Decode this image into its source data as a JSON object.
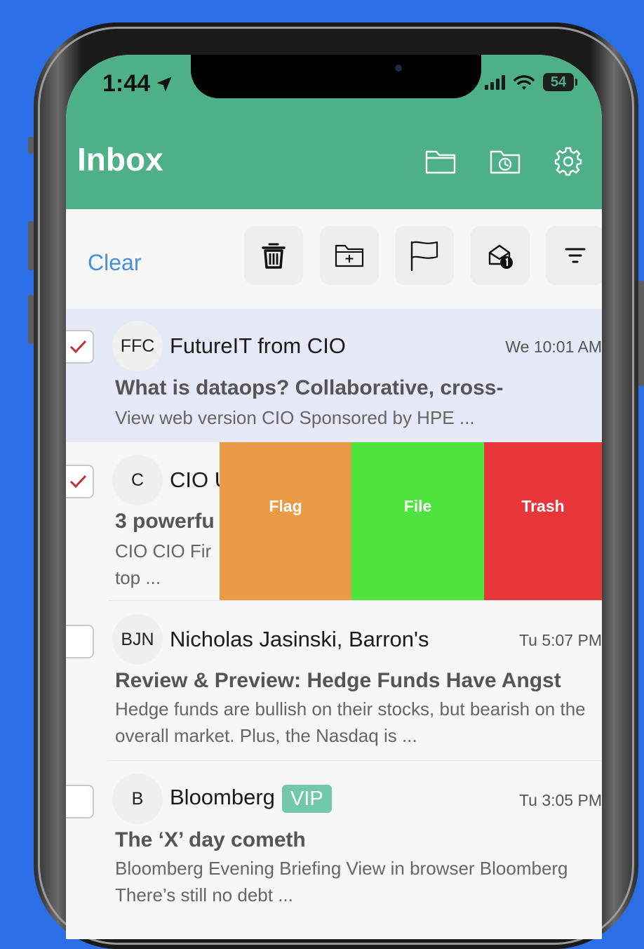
{
  "status_bar": {
    "time": "1:44",
    "battery": "54"
  },
  "header": {
    "title": "Inbox"
  },
  "toolbar": {
    "clear_label": "Clear"
  },
  "swipe_actions": {
    "flag": "Flag",
    "file": "File",
    "trash": "Trash"
  },
  "colors": {
    "header": "#4db088",
    "accent_link": "#4a8fd9",
    "flag": "#eb9b45",
    "file": "#4de43d",
    "trash": "#e7373b",
    "vip": "#73c7ab",
    "selected_row": "#e6eaf8"
  },
  "emails": [
    {
      "initials": "FFC",
      "sender": "FutureIT from CIO",
      "time": "We 10:01 AM",
      "subject": "What is dataops? Collaborative, cross-",
      "preview": "View web version CIO Sponsored by HPE ...",
      "selected": true
    },
    {
      "initials": "C",
      "sender": "CIO U",
      "subject": "3 powerfu",
      "preview": "CIO CIO Fir",
      "preview2": "top ...",
      "selected": true
    },
    {
      "initials": "BJN",
      "sender": "Nicholas Jasinski, Barron's",
      "time": "Tu 5:07 PM",
      "subject": "Review & Preview: Hedge Funds Have Angst",
      "preview": "Hedge funds are bullish on their stocks, but bearish on the overall market. Plus, the Nasdaq is ...",
      "selected": false
    },
    {
      "initials": "B",
      "sender": "Bloomberg",
      "badge": "VIP",
      "time": "Tu 3:05 PM",
      "subject": "The ‘X’ day cometh",
      "preview": "Bloomberg Evening Briefing View in browser Bloomberg There’s still no debt ...",
      "selected": false
    }
  ]
}
